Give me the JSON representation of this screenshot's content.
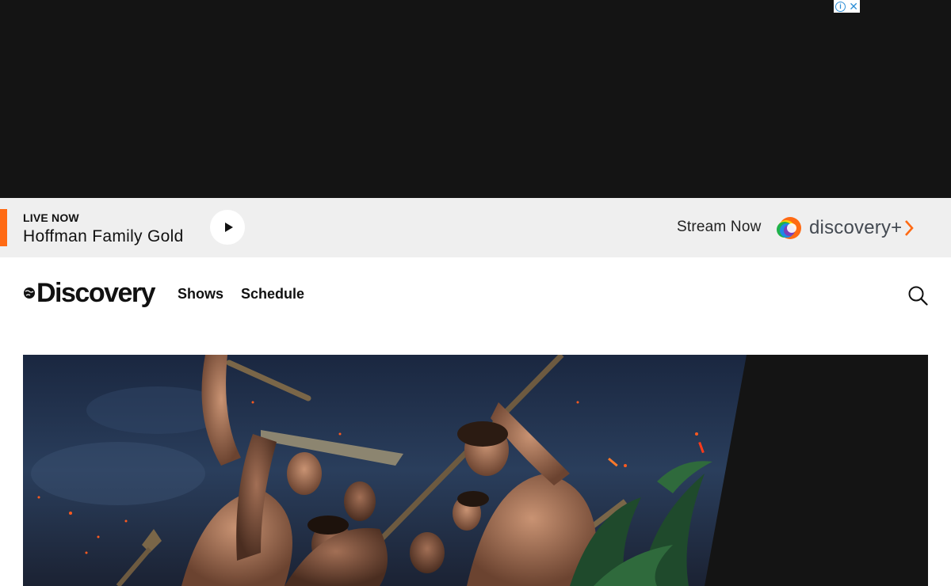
{
  "ad": {
    "choices_info_glyph": "i",
    "choices_close_glyph": "✕"
  },
  "live": {
    "label": "LIVE NOW",
    "show_title": "Hoffman Family Gold",
    "play_icon": "play-icon",
    "accent_color": "#ff6a13"
  },
  "stream": {
    "label": "Stream Now",
    "brand_name": "discovery+"
  },
  "nav": {
    "logo_text": "Discovery",
    "links": [
      "Shows",
      "Schedule"
    ],
    "search_icon": "search-icon"
  },
  "hero": {
    "image_description_icon": "hero-artwork"
  }
}
